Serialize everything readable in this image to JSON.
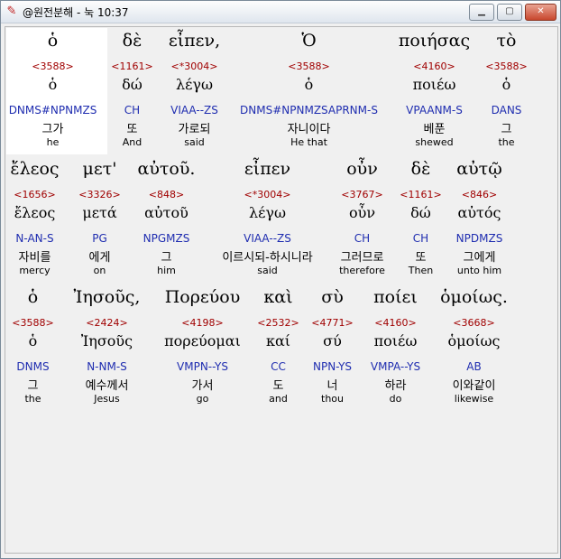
{
  "window": {
    "title": "@원전분해 - 눅 10:37",
    "icon": "app-logo-icon",
    "min_glyph": "▁",
    "max_glyph": "▢",
    "close_glyph": "✕"
  },
  "rows": [
    {
      "words": [
        {
          "greek": "ὁ",
          "strong": "<3588>",
          "lemma": "ὁ",
          "parse": "DNMS#NPNMZS",
          "korean": "그가",
          "english": "he"
        },
        {
          "greek": "δὲ",
          "strong": "<1161>",
          "lemma": "δώ",
          "parse": "CH",
          "korean": "또",
          "english": "And"
        },
        {
          "greek": "εἶπεν,",
          "strong": "<*3004>",
          "lemma": "λέγω",
          "parse": "VIAA--ZS",
          "korean": "가로되",
          "english": "said"
        },
        {
          "greek": "Ὁ",
          "strong": "<3588>",
          "lemma": "ὁ",
          "parse": "DNMS#NPNMZSAPRNM-S",
          "korean": "자니이다",
          "english": "He that"
        },
        {
          "greek": "ποιήσας",
          "strong": "<4160>",
          "lemma": "ποιέω",
          "parse": "VPAANM-S",
          "korean": "베푼",
          "english": "shewed"
        },
        {
          "greek": "τὸ",
          "strong": "<3588>",
          "lemma": "ὁ",
          "parse": "DANS",
          "korean": "그",
          "english": "the"
        }
      ]
    },
    {
      "words": [
        {
          "greek": "ἔλεος",
          "strong": "<1656>",
          "lemma": "ἔλεος",
          "parse": "N-AN-S",
          "korean": "자비를",
          "english": "mercy"
        },
        {
          "greek": "μετ'",
          "strong": "<3326>",
          "lemma": "μετά",
          "parse": "PG",
          "korean": "에게",
          "english": "on"
        },
        {
          "greek": "αὐτοῦ.",
          "strong": "<848>",
          "lemma": "αὐτοῦ",
          "parse": "NPGMZS",
          "korean": "그",
          "english": "him"
        },
        {
          "greek": "εἶπεν",
          "strong": "<*3004>",
          "lemma": "λέγω",
          "parse": "VIAA--ZS",
          "korean": "이르시되-하시니라",
          "english": "said"
        },
        {
          "greek": "οὖν",
          "strong": "<3767>",
          "lemma": "οὖν",
          "parse": "CH",
          "korean": "그러므로",
          "english": "therefore"
        },
        {
          "greek": "δὲ",
          "strong": "<1161>",
          "lemma": "δώ",
          "parse": "CH",
          "korean": "또",
          "english": "Then"
        },
        {
          "greek": "αὐτῷ",
          "strong": "<846>",
          "lemma": "αὐτός",
          "parse": "NPDMZS",
          "korean": "그에게",
          "english": "unto him"
        }
      ]
    },
    {
      "words": [
        {
          "greek": "ὁ",
          "strong": "<3588>",
          "lemma": "ὁ",
          "parse": "DNMS",
          "korean": "그",
          "english": "the"
        },
        {
          "greek": "Ἰησοῦς,",
          "strong": "<2424>",
          "lemma": "Ἰησοῦς",
          "parse": "N-NM-S",
          "korean": "예수께서",
          "english": "Jesus"
        },
        {
          "greek": "Πορεύου",
          "strong": "<4198>",
          "lemma": "πορεύομαι",
          "parse": "VMPN--YS",
          "korean": "가서",
          "english": "go"
        },
        {
          "greek": "καὶ",
          "strong": "<2532>",
          "lemma": "καί",
          "parse": "CC",
          "korean": "도",
          "english": "and"
        },
        {
          "greek": "σὺ",
          "strong": "<4771>",
          "lemma": "σύ",
          "parse": "NPN-YS",
          "korean": "너",
          "english": "thou"
        },
        {
          "greek": "ποίει",
          "strong": "<4160>",
          "lemma": "ποιέω",
          "parse": "VMPA--YS",
          "korean": "하라",
          "english": "do"
        },
        {
          "greek": "ὁμοίως.",
          "strong": "<3668>",
          "lemma": "ὁμοίως",
          "parse": "AB",
          "korean": "이와같이",
          "english": "likewise"
        }
      ]
    }
  ]
}
